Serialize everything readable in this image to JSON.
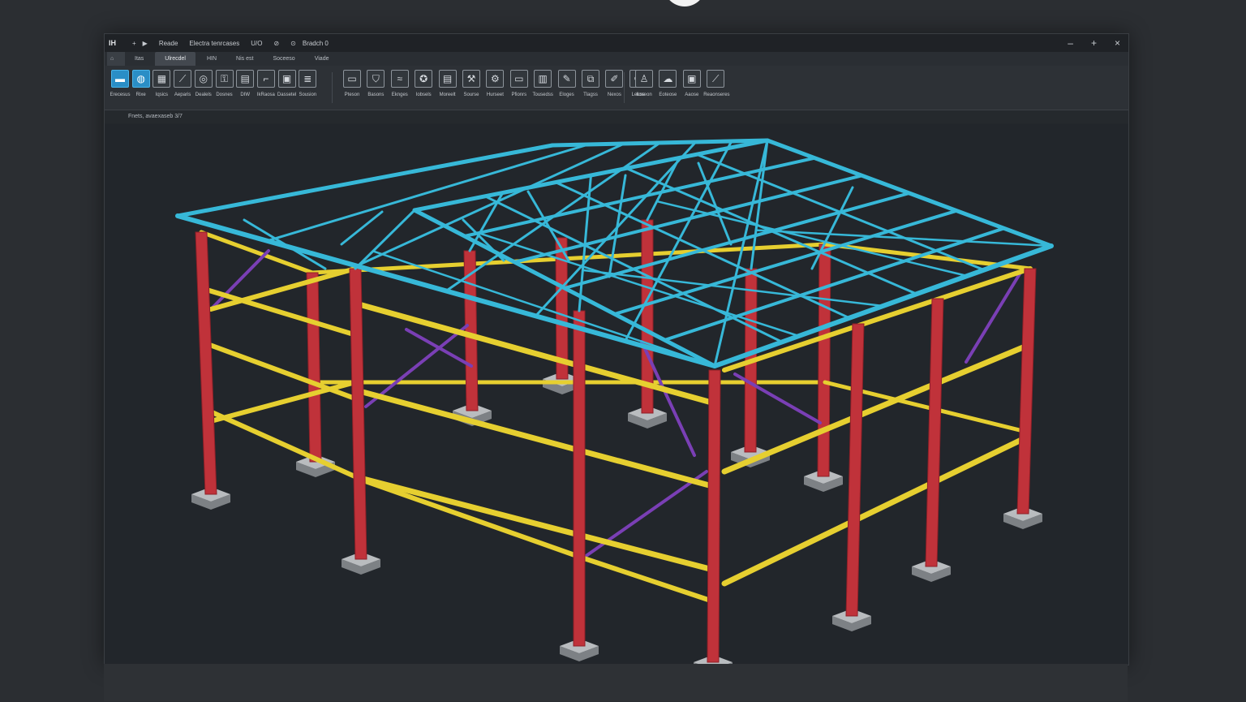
{
  "titlebar": {
    "logo": "IΗ",
    "items": [
      "+",
      "▶",
      "Reade",
      "Electra tenrcases",
      "U/O",
      "⊘",
      "⊙",
      "Bradch 0"
    ],
    "controls": [
      "–",
      "+",
      "×"
    ]
  },
  "tabs": [
    {
      "label": "⌂"
    },
    {
      "label": "Itas"
    },
    {
      "label": "Ulrecdel"
    },
    {
      "label": "HIN"
    },
    {
      "label": "Nis est"
    },
    {
      "label": "Soceeso"
    },
    {
      "label": "Viade"
    }
  ],
  "ribbon": {
    "groups": [
      [
        {
          "label": "Erecesus",
          "icon": "beam-icon",
          "glyph": "▬",
          "accent": true
        },
        {
          "label": "Rixe",
          "icon": "globe-icon",
          "glyph": "◍",
          "accent": true
        },
        {
          "label": "Iqsics",
          "icon": "frame-icon",
          "glyph": "▦"
        },
        {
          "label": "Aeparis",
          "icon": "brace-icon",
          "glyph": "⟋"
        },
        {
          "label": "Dealels",
          "icon": "node-icon",
          "glyph": "◎"
        },
        {
          "label": "Dosnes",
          "icon": "lock-icon",
          "glyph": "⚿"
        },
        {
          "label": "DIW",
          "icon": "grid-icon",
          "glyph": "▤"
        },
        {
          "label": "IkRaosa",
          "icon": "section-icon",
          "glyph": "⌐"
        },
        {
          "label": "Dassetel",
          "icon": "panel-icon",
          "glyph": "▣"
        },
        {
          "label": "Sousion",
          "icon": "stack-icon",
          "glyph": "≣"
        }
      ],
      [
        {
          "label": "Pteson",
          "icon": "monitor-icon",
          "glyph": "▭"
        },
        {
          "label": "Basons",
          "icon": "shield-icon",
          "glyph": "⛉"
        },
        {
          "label": "Eknges",
          "icon": "wave-icon",
          "glyph": "≈"
        },
        {
          "label": "Iobsels",
          "icon": "compass-icon",
          "glyph": "✪"
        },
        {
          "label": "Moreelt",
          "icon": "document-icon",
          "glyph": "▤"
        },
        {
          "label": "Sourse",
          "icon": "tools-icon",
          "glyph": "⚒"
        },
        {
          "label": "Hurseet",
          "icon": "connect-icon",
          "glyph": "⚙"
        },
        {
          "label": "Pfionrs",
          "icon": "window-icon",
          "glyph": "▭"
        },
        {
          "label": "Tousedss",
          "icon": "columns-icon",
          "glyph": "▥"
        },
        {
          "label": "Eloges",
          "icon": "edit-icon",
          "glyph": "✎"
        },
        {
          "label": "Tlagss",
          "icon": "copy-icon",
          "glyph": "⧉"
        },
        {
          "label": "Nexos",
          "icon": "pen-icon",
          "glyph": "✐"
        },
        {
          "label": "Leuse",
          "icon": "pencil-icon",
          "glyph": "✏"
        }
      ],
      [
        {
          "label": "Iloseon",
          "icon": "user-icon",
          "glyph": "♙"
        },
        {
          "label": "Eoteose",
          "icon": "cloud-icon",
          "glyph": "☁"
        },
        {
          "label": "Aaose",
          "icon": "display-icon",
          "glyph": "▣"
        },
        {
          "label": "Reaonseres",
          "icon": "analysis-icon",
          "glyph": "⟋"
        }
      ]
    ]
  },
  "status": {
    "text": "Fnets, avaexaseb 3/7"
  },
  "model": {
    "colors": {
      "column": "#c0323a",
      "beam": "#e6cf30",
      "roof": "#37b8d8",
      "brace": "#7a3fb5",
      "footing": "#9ea2a6",
      "background": "#22262b"
    }
  }
}
